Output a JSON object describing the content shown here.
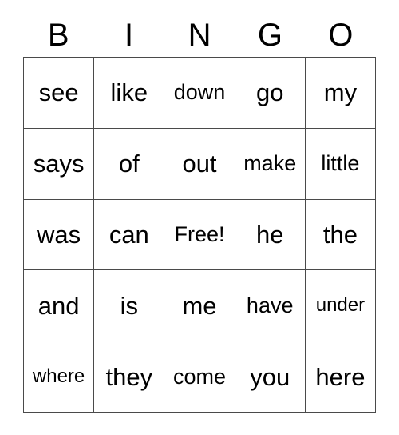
{
  "card": {
    "header_letters": [
      "B",
      "I",
      "N",
      "G",
      "O"
    ],
    "free_space_label": "Free!",
    "colors": {
      "background": "#ffffff",
      "grid_line": "#4a4a4a",
      "text": "#000000"
    },
    "rows": [
      [
        {
          "text": "see",
          "size": "lg"
        },
        {
          "text": "like",
          "size": "lg"
        },
        {
          "text": "down",
          "size": "md"
        },
        {
          "text": "go",
          "size": "lg"
        },
        {
          "text": "my",
          "size": "lg"
        }
      ],
      [
        {
          "text": "says",
          "size": "lg"
        },
        {
          "text": "of",
          "size": "lg"
        },
        {
          "text": "out",
          "size": "lg"
        },
        {
          "text": "make",
          "size": "md"
        },
        {
          "text": "little",
          "size": "md"
        }
      ],
      [
        {
          "text": "was",
          "size": "lg"
        },
        {
          "text": "can",
          "size": "lg"
        },
        {
          "text": "Free!",
          "size": "md"
        },
        {
          "text": "he",
          "size": "lg"
        },
        {
          "text": "the",
          "size": "lg"
        }
      ],
      [
        {
          "text": "and",
          "size": "lg"
        },
        {
          "text": "is",
          "size": "lg"
        },
        {
          "text": "me",
          "size": "lg"
        },
        {
          "text": "have",
          "size": "md"
        },
        {
          "text": "under",
          "size": "sm"
        }
      ],
      [
        {
          "text": "where",
          "size": "sm"
        },
        {
          "text": "they",
          "size": "lg"
        },
        {
          "text": "come",
          "size": "md"
        },
        {
          "text": "you",
          "size": "lg"
        },
        {
          "text": "here",
          "size": "lg"
        }
      ]
    ]
  }
}
